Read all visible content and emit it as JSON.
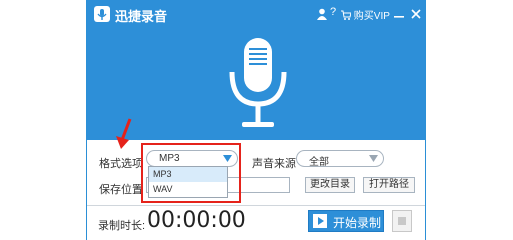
{
  "app": {
    "title": "迅捷录音"
  },
  "titlebar": {
    "help": "?",
    "vip_label": "购买VIP"
  },
  "form": {
    "format_label": "格式选项",
    "format_value": "MP3",
    "format_options": [
      "MP3",
      "WAV"
    ],
    "source_label": "声音来源",
    "source_value": "全部",
    "save_label": "保存位置",
    "save_path_placeholder": "C",
    "change_dir_label": "更改目录",
    "open_path_label": "打开路径"
  },
  "footer": {
    "timer_label": "录制时长:",
    "timer_value": "00:00:00",
    "start_label": "开始录制"
  },
  "colors": {
    "accent": "#2d8fd8",
    "highlight": "#e5231b"
  }
}
